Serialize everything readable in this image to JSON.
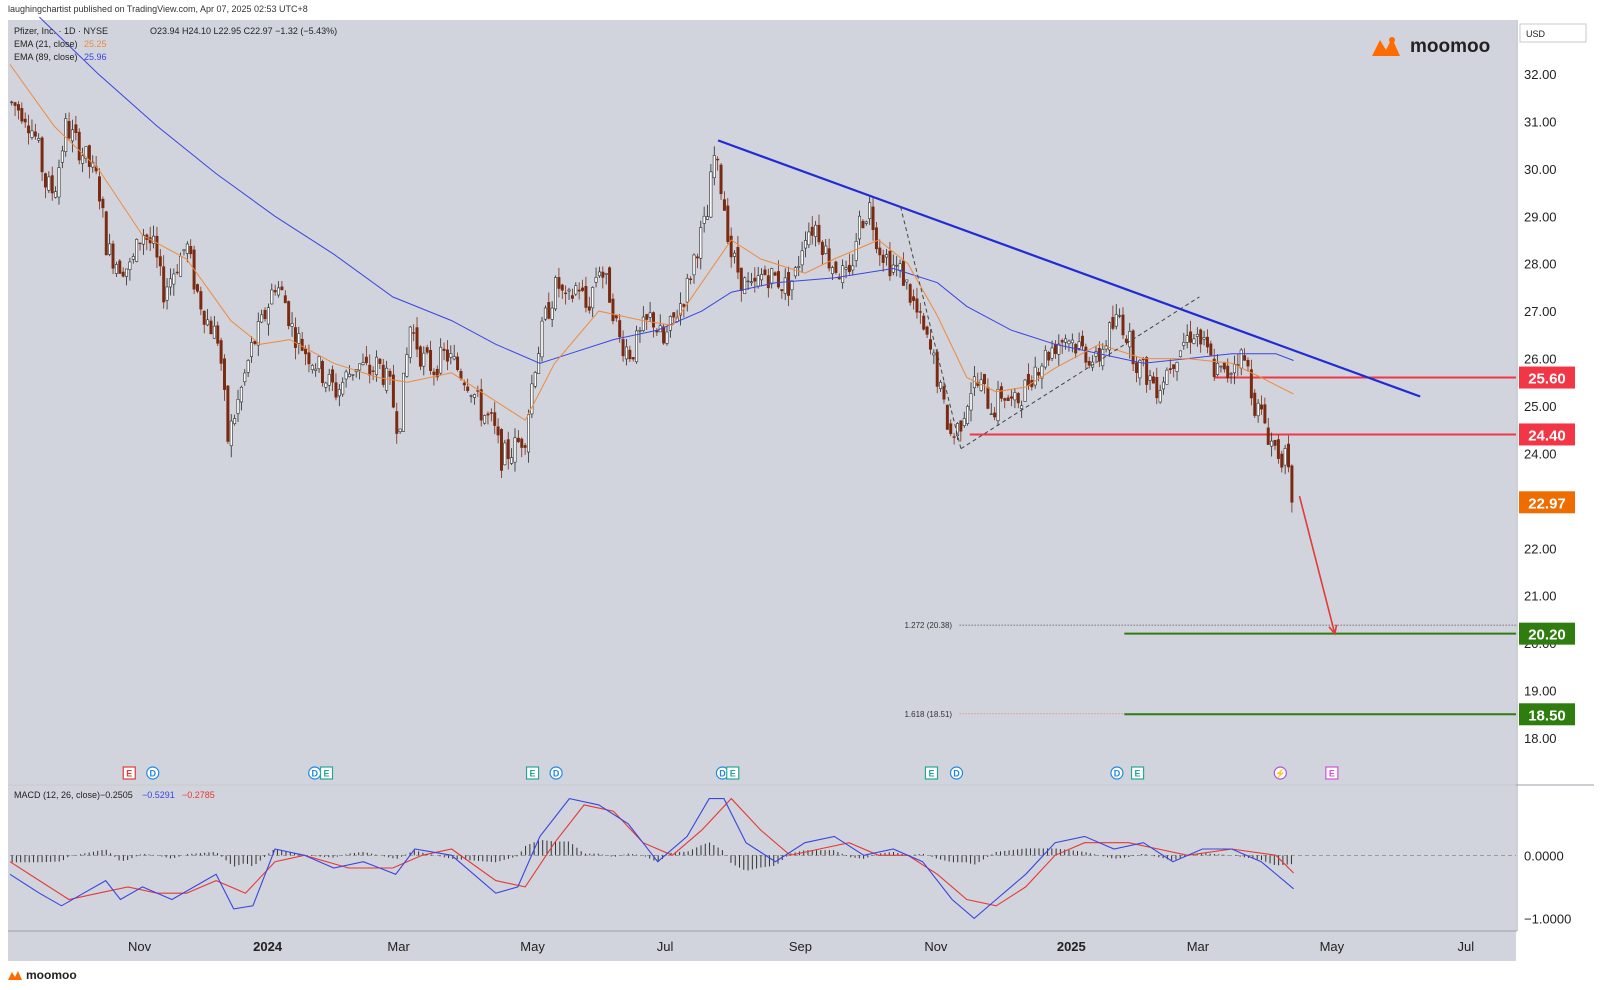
{
  "publisher_line": "laughingchartist published on TradingView.com, Apr 07, 2025 02:53 UTC+8",
  "footer_brand": "moomoo",
  "chart_data": {
    "type": "candlestick",
    "symbol": "Pfizer, Inc. · 1D · NYSE",
    "ohlc_text": "O23.94  H24.10  L22.95  C22.97  −1.32 (−5.43%)",
    "ema21_label": "EMA (21, close)",
    "ema21_value": "25.25",
    "ema89_label": "EMA (89, close)",
    "ema89_value": "25.96",
    "currency": "USD",
    "brand": "moomoo",
    "price_axis": {
      "range": [
        17.0,
        33.0
      ],
      "ticks": [
        "32.00",
        "31.00",
        "30.00",
        "29.00",
        "28.00",
        "27.00",
        "26.00",
        "25.00",
        "24.00",
        "22.00",
        "21.00",
        "20.00",
        "19.00",
        "18.00"
      ]
    },
    "time_axis": {
      "ticks": [
        {
          "label": "Nov",
          "t": 0.088,
          "bold": false
        },
        {
          "label": "2024",
          "t": 0.175,
          "bold": true
        },
        {
          "label": "Mar",
          "t": 0.264,
          "bold": false
        },
        {
          "label": "May",
          "t": 0.355,
          "bold": false
        },
        {
          "label": "Jul",
          "t": 0.445,
          "bold": false
        },
        {
          "label": "Sep",
          "t": 0.537,
          "bold": false
        },
        {
          "label": "Nov",
          "t": 0.629,
          "bold": false
        },
        {
          "label": "2025",
          "t": 0.721,
          "bold": true
        },
        {
          "label": "Mar",
          "t": 0.807,
          "bold": false
        },
        {
          "label": "May",
          "t": 0.898,
          "bold": false
        },
        {
          "label": "Jul",
          "t": 0.989,
          "bold": false
        }
      ]
    },
    "price_path": [
      [
        0.0,
        31.4
      ],
      [
        0.01,
        31.2
      ],
      [
        0.018,
        30.6
      ],
      [
        0.024,
        29.7
      ],
      [
        0.03,
        29.5
      ],
      [
        0.038,
        30.9
      ],
      [
        0.046,
        30.5
      ],
      [
        0.052,
        30.2
      ],
      [
        0.06,
        29.7
      ],
      [
        0.066,
        28.3
      ],
      [
        0.074,
        28.0
      ],
      [
        0.082,
        27.9
      ],
      [
        0.09,
        28.7
      ],
      [
        0.098,
        28.3
      ],
      [
        0.104,
        27.4
      ],
      [
        0.112,
        27.9
      ],
      [
        0.12,
        28.4
      ],
      [
        0.126,
        27.5
      ],
      [
        0.134,
        26.8
      ],
      [
        0.142,
        26.4
      ],
      [
        0.148,
        24.3
      ],
      [
        0.156,
        25.2
      ],
      [
        0.164,
        26.2
      ],
      [
        0.172,
        26.8
      ],
      [
        0.18,
        27.6
      ],
      [
        0.186,
        27.3
      ],
      [
        0.192,
        26.6
      ],
      [
        0.2,
        26.2
      ],
      [
        0.208,
        25.9
      ],
      [
        0.214,
        25.6
      ],
      [
        0.222,
        25.3
      ],
      [
        0.228,
        25.6
      ],
      [
        0.236,
        25.9
      ],
      [
        0.244,
        25.7
      ],
      [
        0.25,
        25.9
      ],
      [
        0.258,
        25.4
      ],
      [
        0.264,
        24.5
      ],
      [
        0.272,
        26.7
      ],
      [
        0.28,
        26.0
      ],
      [
        0.288,
        25.8
      ],
      [
        0.296,
        26.1
      ],
      [
        0.304,
        25.8
      ],
      [
        0.312,
        25.5
      ],
      [
        0.32,
        24.9
      ],
      [
        0.328,
        24.6
      ],
      [
        0.334,
        23.9
      ],
      [
        0.342,
        24.1
      ],
      [
        0.35,
        24.4
      ],
      [
        0.356,
        25.8
      ],
      [
        0.364,
        26.9
      ],
      [
        0.372,
        27.6
      ],
      [
        0.378,
        27.1
      ],
      [
        0.386,
        27.6
      ],
      [
        0.392,
        27.0
      ],
      [
        0.4,
        28.0
      ],
      [
        0.408,
        27.3
      ],
      [
        0.414,
        26.4
      ],
      [
        0.422,
        26.1
      ],
      [
        0.43,
        26.6
      ],
      [
        0.436,
        26.9
      ],
      [
        0.444,
        26.3
      ],
      [
        0.452,
        26.9
      ],
      [
        0.46,
        27.5
      ],
      [
        0.466,
        28.3
      ],
      [
        0.474,
        29.0
      ],
      [
        0.478,
        30.3
      ],
      [
        0.484,
        29.5
      ],
      [
        0.49,
        28.2
      ],
      [
        0.498,
        27.6
      ],
      [
        0.504,
        27.4
      ],
      [
        0.512,
        27.8
      ],
      [
        0.52,
        27.7
      ],
      [
        0.528,
        27.5
      ],
      [
        0.534,
        27.8
      ],
      [
        0.54,
        28.7
      ],
      [
        0.548,
        28.8
      ],
      [
        0.556,
        28.1
      ],
      [
        0.562,
        27.9
      ],
      [
        0.57,
        27.6
      ],
      [
        0.576,
        28.8
      ],
      [
        0.584,
        29.2
      ],
      [
        0.59,
        28.4
      ],
      [
        0.598,
        28.0
      ],
      [
        0.606,
        27.8
      ],
      [
        0.612,
        27.3
      ],
      [
        0.62,
        26.6
      ],
      [
        0.628,
        25.9
      ],
      [
        0.634,
        25.0
      ],
      [
        0.64,
        24.3
      ],
      [
        0.646,
        24.7
      ],
      [
        0.654,
        25.5
      ],
      [
        0.66,
        25.4
      ],
      [
        0.668,
        24.9
      ],
      [
        0.674,
        25.3
      ],
      [
        0.682,
        25.0
      ],
      [
        0.69,
        25.4
      ],
      [
        0.696,
        25.8
      ],
      [
        0.702,
        26.0
      ],
      [
        0.71,
        26.3
      ],
      [
        0.718,
        26.5
      ],
      [
        0.724,
        26.3
      ],
      [
        0.732,
        26.1
      ],
      [
        0.738,
        25.9
      ],
      [
        0.746,
        26.5
      ],
      [
        0.754,
        26.9
      ],
      [
        0.76,
        26.4
      ],
      [
        0.766,
        25.9
      ],
      [
        0.774,
        25.6
      ],
      [
        0.78,
        25.4
      ],
      [
        0.788,
        25.9
      ],
      [
        0.796,
        26.3
      ],
      [
        0.804,
        26.6
      ],
      [
        0.812,
        26.2
      ],
      [
        0.818,
        25.8
      ],
      [
        0.826,
        25.6
      ],
      [
        0.834,
        26.1
      ],
      [
        0.84,
        25.9
      ],
      [
        0.846,
        25.0
      ],
      [
        0.852,
        24.7
      ],
      [
        0.856,
        24.3
      ],
      [
        0.86,
        24.1
      ],
      [
        0.866,
        23.9
      ],
      [
        0.872,
        22.97
      ]
    ],
    "ema21_path": [
      [
        0.0,
        32.2
      ],
      [
        0.03,
        30.9
      ],
      [
        0.06,
        30.0
      ],
      [
        0.09,
        28.6
      ],
      [
        0.12,
        28.1
      ],
      [
        0.15,
        26.8
      ],
      [
        0.17,
        26.3
      ],
      [
        0.19,
        26.4
      ],
      [
        0.22,
        25.9
      ],
      [
        0.25,
        25.6
      ],
      [
        0.27,
        25.5
      ],
      [
        0.3,
        25.7
      ],
      [
        0.33,
        25.1
      ],
      [
        0.35,
        24.7
      ],
      [
        0.37,
        25.9
      ],
      [
        0.4,
        27.0
      ],
      [
        0.43,
        26.8
      ],
      [
        0.45,
        26.7
      ],
      [
        0.47,
        27.6
      ],
      [
        0.49,
        28.5
      ],
      [
        0.51,
        28.1
      ],
      [
        0.54,
        27.8
      ],
      [
        0.56,
        28.1
      ],
      [
        0.59,
        28.5
      ],
      [
        0.61,
        28.0
      ],
      [
        0.63,
        26.9
      ],
      [
        0.65,
        25.6
      ],
      [
        0.67,
        25.3
      ],
      [
        0.69,
        25.4
      ],
      [
        0.71,
        25.8
      ],
      [
        0.74,
        26.3
      ],
      [
        0.77,
        26.0
      ],
      [
        0.8,
        26.0
      ],
      [
        0.83,
        25.9
      ],
      [
        0.85,
        25.6
      ],
      [
        0.872,
        25.25
      ]
    ],
    "ema89_path": [
      [
        0.02,
        33.2
      ],
      [
        0.06,
        32.0
      ],
      [
        0.1,
        30.9
      ],
      [
        0.14,
        29.9
      ],
      [
        0.18,
        29.0
      ],
      [
        0.22,
        28.2
      ],
      [
        0.26,
        27.3
      ],
      [
        0.3,
        26.8
      ],
      [
        0.33,
        26.3
      ],
      [
        0.36,
        25.9
      ],
      [
        0.38,
        26.1
      ],
      [
        0.41,
        26.4
      ],
      [
        0.44,
        26.6
      ],
      [
        0.47,
        27.0
      ],
      [
        0.49,
        27.4
      ],
      [
        0.52,
        27.6
      ],
      [
        0.56,
        27.7
      ],
      [
        0.6,
        27.9
      ],
      [
        0.63,
        27.6
      ],
      [
        0.65,
        27.1
      ],
      [
        0.68,
        26.6
      ],
      [
        0.71,
        26.3
      ],
      [
        0.74,
        26.1
      ],
      [
        0.77,
        25.9
      ],
      [
        0.8,
        26.0
      ],
      [
        0.83,
        26.1
      ],
      [
        0.86,
        26.1
      ],
      [
        0.872,
        25.96
      ]
    ],
    "trendline": [
      [
        0.481,
        30.6
      ],
      [
        0.958,
        25.2
      ]
    ],
    "wedge_lines": [
      [
        [
          0.605,
          29.2
        ],
        [
          0.646,
          24.1
        ]
      ],
      [
        [
          0.646,
          24.1
        ],
        [
          0.808,
          27.3
        ]
      ]
    ],
    "levels": [
      {
        "price": 25.6,
        "label": "25.60",
        "color": "#f23645",
        "from_t": 0.818,
        "to_t": 1.0
      },
      {
        "price": 24.4,
        "label": "24.40",
        "color": "#f23645",
        "from_t": 0.652,
        "to_t": 1.0
      },
      {
        "price": 22.97,
        "label": "22.97",
        "color": "#ef6c00",
        "from_t": 1.0,
        "to_t": 1.0
      },
      {
        "price": 20.2,
        "label": "20.20",
        "color": "#2e7d0e",
        "from_t": 0.757,
        "to_t": 1.0
      },
      {
        "price": 18.5,
        "label": "18.50",
        "color": "#2e7d0e",
        "from_t": 0.757,
        "to_t": 1.0
      }
    ],
    "fib_levels": [
      {
        "label": "1.272 (20.38)",
        "price": 20.38,
        "color": "#555555"
      },
      {
        "label": "1.618 (18.51)",
        "price": 18.51,
        "color": "#e57373"
      }
    ],
    "projection_arrow": [
      [
        0.876,
        23.1
      ],
      [
        0.9,
        20.2
      ]
    ],
    "event_markers": [
      {
        "t": 0.081,
        "kind": "E",
        "color": "#e53935"
      },
      {
        "t": 0.097,
        "kind": "D",
        "color": "#1e88e5"
      },
      {
        "t": 0.207,
        "kind": "D",
        "color": "#1e88e5"
      },
      {
        "t": 0.215,
        "kind": "E",
        "color": "#26a69a"
      },
      {
        "t": 0.355,
        "kind": "E",
        "color": "#26a69a"
      },
      {
        "t": 0.371,
        "kind": "D",
        "color": "#1e88e5"
      },
      {
        "t": 0.484,
        "kind": "D",
        "color": "#1e88e5"
      },
      {
        "t": 0.491,
        "kind": "E",
        "color": "#26a69a"
      },
      {
        "t": 0.626,
        "kind": "E",
        "color": "#26a69a"
      },
      {
        "t": 0.643,
        "kind": "D",
        "color": "#1e88e5"
      },
      {
        "t": 0.752,
        "kind": "D",
        "color": "#1e88e5"
      },
      {
        "t": 0.766,
        "kind": "E",
        "color": "#26a69a"
      },
      {
        "t": 0.863,
        "kind": "⚡",
        "color": "#b04fd6"
      },
      {
        "t": 0.898,
        "kind": "E",
        "color": "#d64fd6"
      }
    ],
    "macd": {
      "label": "MACD (12, 26, close)",
      "histogram_value": "−0.2505",
      "macd_value": "−0.5291",
      "signal_value": "−0.2785",
      "axis_ticks": [
        "0.0000",
        "−1.0000"
      ],
      "range": [
        -1.2,
        1.1
      ],
      "macd_path": [
        [
          0.0,
          -0.3
        ],
        [
          0.02,
          -0.6
        ],
        [
          0.035,
          -0.8
        ],
        [
          0.05,
          -0.6
        ],
        [
          0.065,
          -0.4
        ],
        [
          0.075,
          -0.7
        ],
        [
          0.09,
          -0.5
        ],
        [
          0.11,
          -0.7
        ],
        [
          0.125,
          -0.5
        ],
        [
          0.14,
          -0.3
        ],
        [
          0.152,
          -0.85
        ],
        [
          0.165,
          -0.8
        ],
        [
          0.18,
          0.1
        ],
        [
          0.2,
          0.0
        ],
        [
          0.22,
          -0.2
        ],
        [
          0.24,
          -0.1
        ],
        [
          0.262,
          -0.3
        ],
        [
          0.275,
          0.1
        ],
        [
          0.3,
          0.0
        ],
        [
          0.33,
          -0.6
        ],
        [
          0.345,
          -0.5
        ],
        [
          0.36,
          0.3
        ],
        [
          0.38,
          0.9
        ],
        [
          0.4,
          0.8
        ],
        [
          0.42,
          0.5
        ],
        [
          0.44,
          -0.1
        ],
        [
          0.46,
          0.3
        ],
        [
          0.475,
          0.9
        ],
        [
          0.485,
          0.9
        ],
        [
          0.5,
          0.2
        ],
        [
          0.52,
          -0.1
        ],
        [
          0.54,
          0.2
        ],
        [
          0.56,
          0.3
        ],
        [
          0.58,
          0.0
        ],
        [
          0.6,
          0.1
        ],
        [
          0.62,
          -0.1
        ],
        [
          0.64,
          -0.7
        ],
        [
          0.655,
          -1.0
        ],
        [
          0.67,
          -0.7
        ],
        [
          0.69,
          -0.3
        ],
        [
          0.71,
          0.2
        ],
        [
          0.73,
          0.3
        ],
        [
          0.75,
          0.1
        ],
        [
          0.77,
          0.2
        ],
        [
          0.79,
          -0.1
        ],
        [
          0.81,
          0.1
        ],
        [
          0.83,
          0.1
        ],
        [
          0.85,
          -0.1
        ],
        [
          0.872,
          -0.53
        ]
      ],
      "signal_path": [
        [
          0.0,
          -0.1
        ],
        [
          0.02,
          -0.4
        ],
        [
          0.04,
          -0.7
        ],
        [
          0.06,
          -0.6
        ],
        [
          0.08,
          -0.5
        ],
        [
          0.1,
          -0.6
        ],
        [
          0.12,
          -0.6
        ],
        [
          0.14,
          -0.4
        ],
        [
          0.16,
          -0.6
        ],
        [
          0.18,
          -0.1
        ],
        [
          0.2,
          0.0
        ],
        [
          0.23,
          -0.2
        ],
        [
          0.26,
          -0.2
        ],
        [
          0.28,
          0.0
        ],
        [
          0.3,
          0.1
        ],
        [
          0.33,
          -0.4
        ],
        [
          0.35,
          -0.5
        ],
        [
          0.37,
          0.2
        ],
        [
          0.39,
          0.8
        ],
        [
          0.41,
          0.7
        ],
        [
          0.43,
          0.2
        ],
        [
          0.45,
          0.0
        ],
        [
          0.47,
          0.4
        ],
        [
          0.49,
          0.9
        ],
        [
          0.51,
          0.4
        ],
        [
          0.53,
          0.0
        ],
        [
          0.55,
          0.1
        ],
        [
          0.57,
          0.2
        ],
        [
          0.59,
          0.0
        ],
        [
          0.61,
          0.0
        ],
        [
          0.63,
          -0.3
        ],
        [
          0.65,
          -0.7
        ],
        [
          0.67,
          -0.8
        ],
        [
          0.69,
          -0.5
        ],
        [
          0.71,
          0.0
        ],
        [
          0.73,
          0.2
        ],
        [
          0.76,
          0.2
        ],
        [
          0.78,
          0.1
        ],
        [
          0.8,
          0.0
        ],
        [
          0.83,
          0.1
        ],
        [
          0.86,
          0.0
        ],
        [
          0.872,
          -0.28
        ]
      ]
    }
  }
}
